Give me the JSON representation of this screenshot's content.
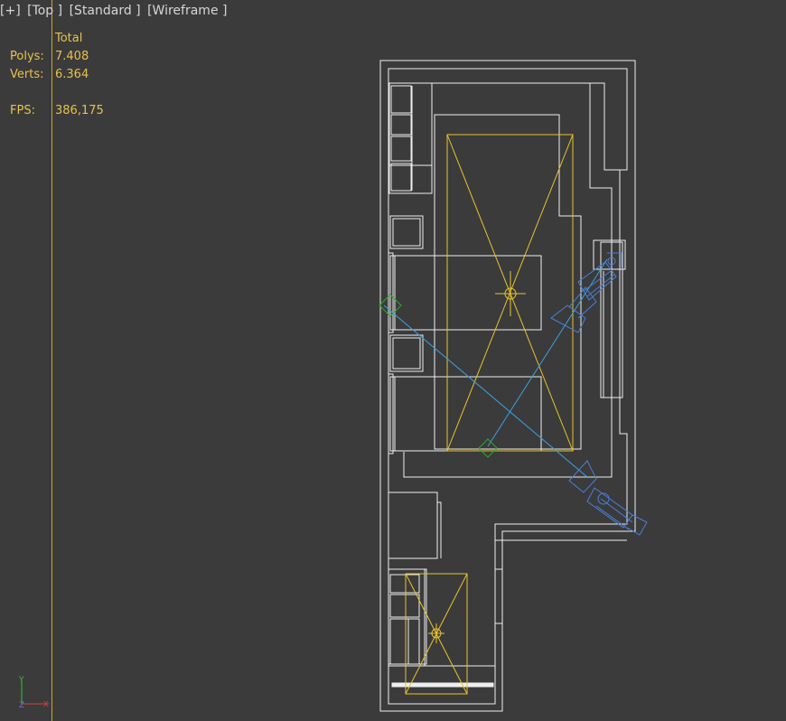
{
  "viewport": {
    "labels": {
      "menu": "[+]",
      "view": "[Top ]",
      "shading_style": "[Standard ]",
      "display_mode": "[Wireframe ]"
    },
    "stats": {
      "header": "Total",
      "polys_label": "Polys:",
      "polys_value": "7.408",
      "verts_label": "Verts:",
      "verts_value": "6.364",
      "fps_label": "FPS:",
      "fps_value": "386,175"
    },
    "axis_gizmo": {
      "y": "Y",
      "z": "Z",
      "x": "X"
    },
    "colors": {
      "background": "#3b3b3b",
      "geometry": "#f2f2f2",
      "selected": "#e8c32f",
      "camera": "#4a7fd8",
      "helper_green": "#2ea62e",
      "light_blue": "#3aa0e0"
    }
  }
}
